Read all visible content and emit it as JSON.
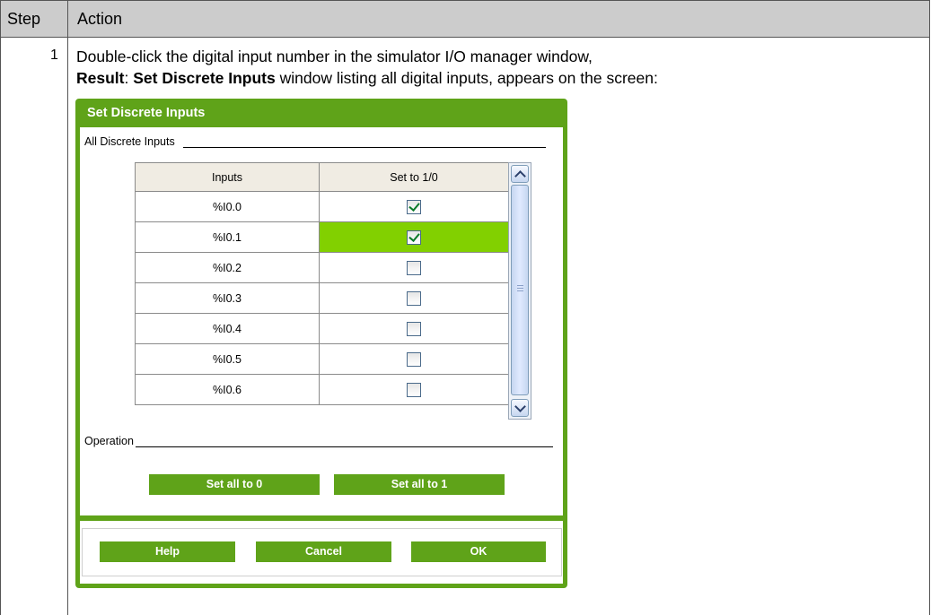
{
  "table": {
    "headers": {
      "step": "Step",
      "action": "Action"
    },
    "row": {
      "step": "1",
      "line1": "Double-click the digital input number in the simulator I/O manager window,",
      "result_label": "Result",
      "result_sep": ": ",
      "result_window": "Set Discrete Inputs",
      "result_rest": " window listing all digital inputs, appears on the screen:"
    }
  },
  "dialog": {
    "title": "Set Discrete Inputs",
    "group_label": "All Discrete Inputs",
    "columns": [
      "Inputs",
      "Set to 1/0"
    ],
    "rows": [
      {
        "input": "%I0.0",
        "checked": true
      },
      {
        "input": "%I0.1",
        "checked": true,
        "selected": true
      },
      {
        "input": "%I0.2",
        "checked": false
      },
      {
        "input": "%I0.3",
        "checked": false
      },
      {
        "input": "%I0.4",
        "checked": false
      },
      {
        "input": "%I0.5",
        "checked": false
      },
      {
        "input": "%I0.6",
        "checked": false
      }
    ],
    "operation_label": "Operation",
    "set_all_0": "Set all to 0",
    "set_all_1": "Set all to 1",
    "help": "Help",
    "cancel": "Cancel",
    "ok": "OK",
    "accent_color": "#5fa319",
    "selected_color": "#82d000"
  }
}
